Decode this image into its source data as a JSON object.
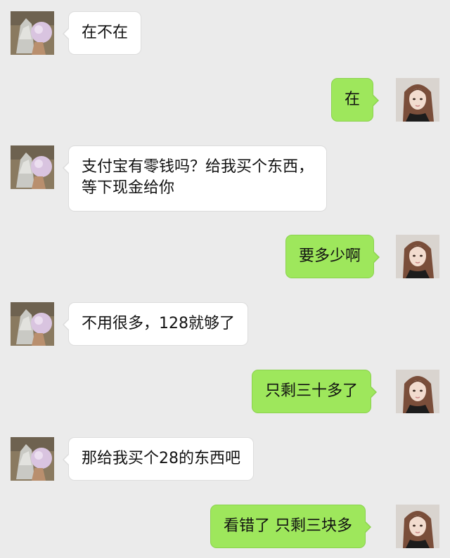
{
  "chat": {
    "messages": [
      {
        "side": "in",
        "lines": [
          "在不在"
        ]
      },
      {
        "side": "out",
        "lines": [
          "在"
        ]
      },
      {
        "side": "in",
        "lines": [
          "支付宝有零钱吗？给我买个东西，",
          "等下现金给你"
        ]
      },
      {
        "side": "out",
        "lines": [
          "要多少啊"
        ]
      },
      {
        "side": "in",
        "lines": [
          "不用很多，128就够了"
        ]
      },
      {
        "side": "out",
        "lines": [
          "只剩三十多了"
        ]
      },
      {
        "side": "in",
        "lines": [
          "那给我买个28的东西吧"
        ]
      },
      {
        "side": "out",
        "lines": [
          "看错了 只剩三块多"
        ]
      }
    ]
  },
  "avatars": {
    "contact": "contact-avatar-icon",
    "self": "self-avatar-icon"
  },
  "colors": {
    "background": "#ebebeb",
    "incoming_bubble": "#ffffff",
    "outgoing_bubble": "#9ee75c"
  }
}
